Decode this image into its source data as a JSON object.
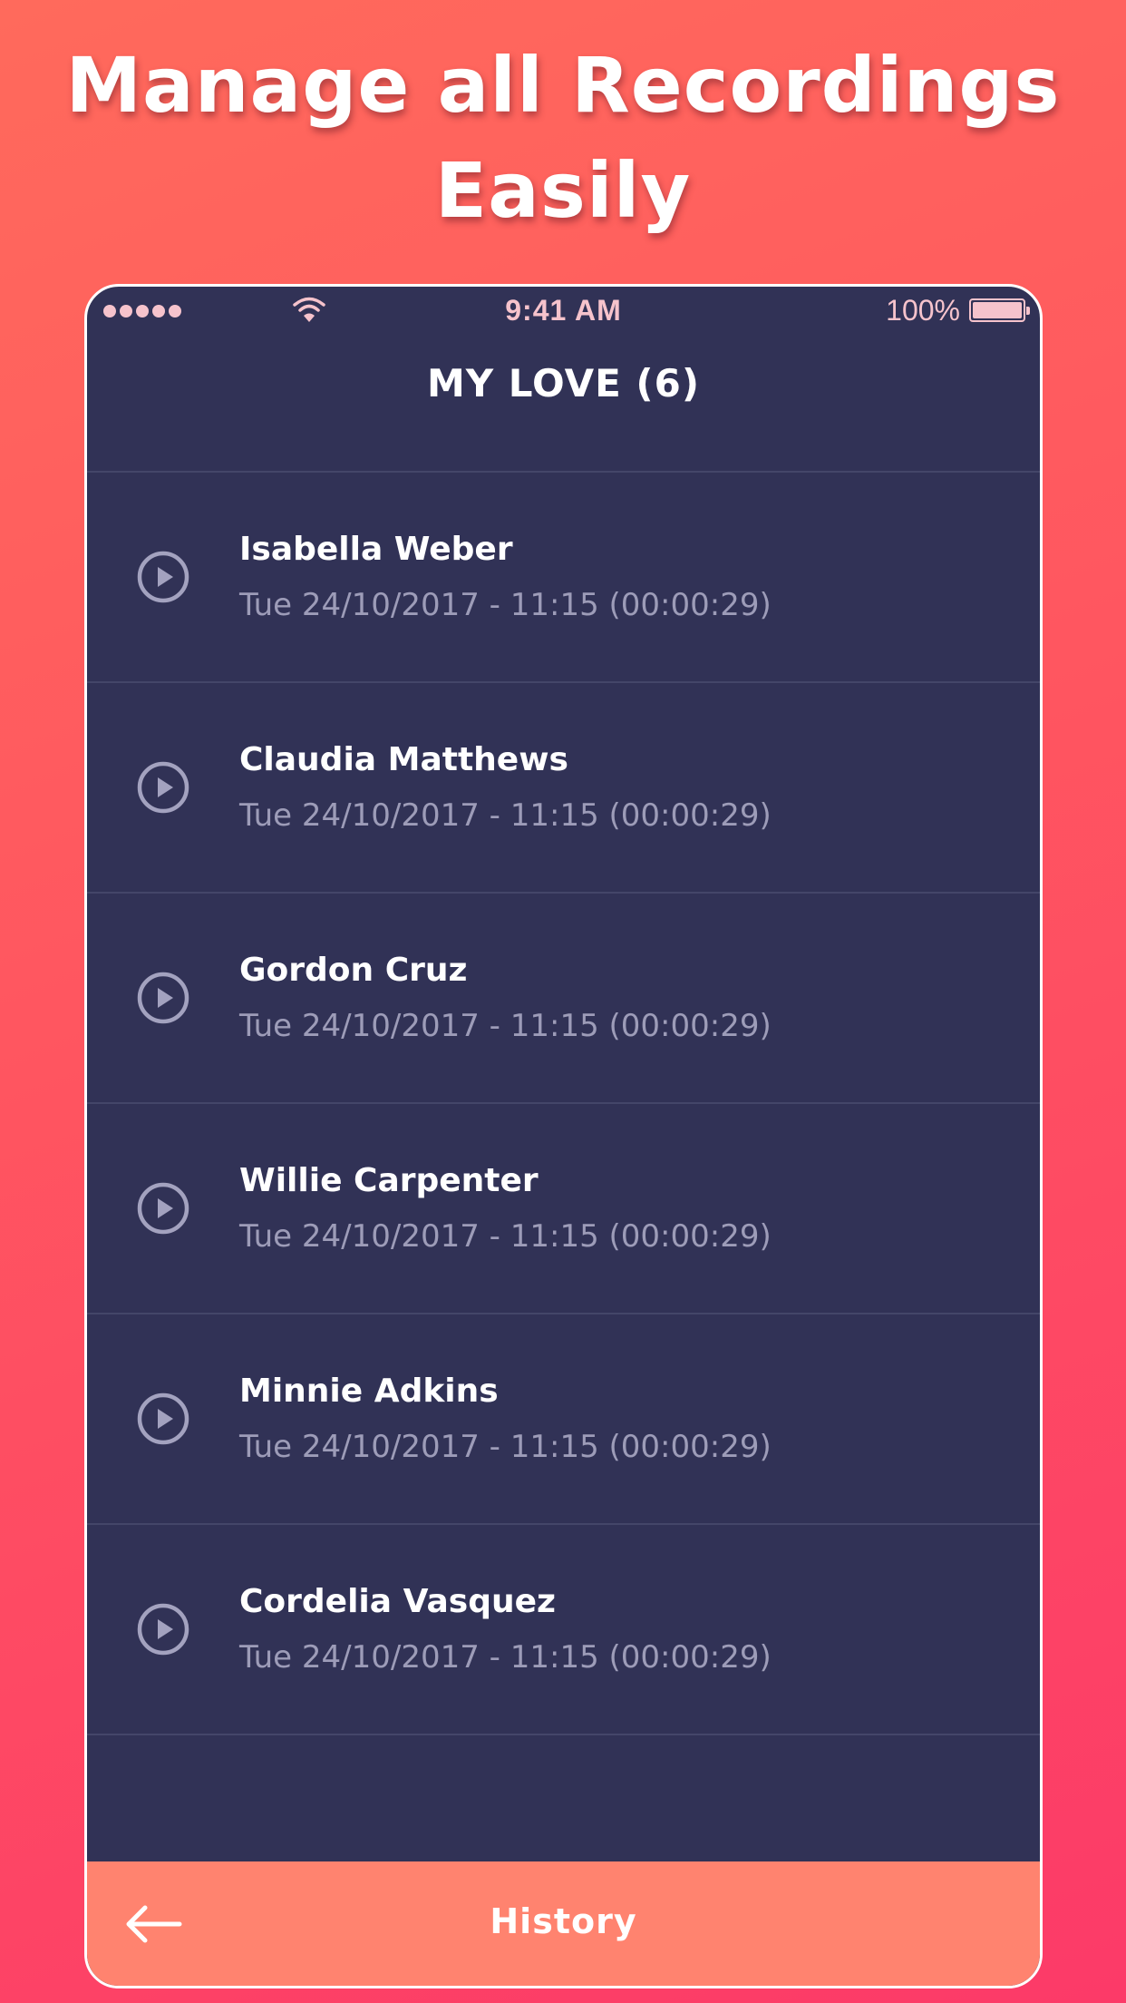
{
  "headline": {
    "line1": "Manage all Recordings",
    "line2": "Easily"
  },
  "status_bar": {
    "time": "9:41 AM",
    "battery_percent": "100%",
    "signal_icon": "signal-dots-icon",
    "wifi_icon": "wifi-icon",
    "battery_icon": "battery-icon",
    "battery_level": 1.0
  },
  "header": {
    "title": "MY LOVE (6)"
  },
  "recordings": [
    {
      "name": "Isabella Weber",
      "meta": "Tue 24/10/2017 - 11:15 (00:00:29)"
    },
    {
      "name": "Claudia Matthews",
      "meta": "Tue 24/10/2017 - 11:15 (00:00:29)"
    },
    {
      "name": "Gordon Cruz",
      "meta": "Tue 24/10/2017 - 11:15 (00:00:29)"
    },
    {
      "name": "Willie Carpenter",
      "meta": "Tue 24/10/2017 - 11:15 (00:00:29)"
    },
    {
      "name": "Minnie Adkins",
      "meta": "Tue 24/10/2017 - 11:15 (00:00:29)"
    },
    {
      "name": "Cordelia Vasquez",
      "meta": "Tue 24/10/2017 - 11:15 (00:00:29)"
    }
  ],
  "bottom_bar": {
    "label": "History",
    "back_icon": "back-arrow-icon"
  },
  "colors": {
    "background_top": "#ff6a5c",
    "background_bottom": "#fc3a68",
    "screen": "#313256",
    "divider": "#444669",
    "bottom_bar": "#ff836f",
    "status_text": "#f6c3cc",
    "secondary_text": "#9d9cb8"
  }
}
